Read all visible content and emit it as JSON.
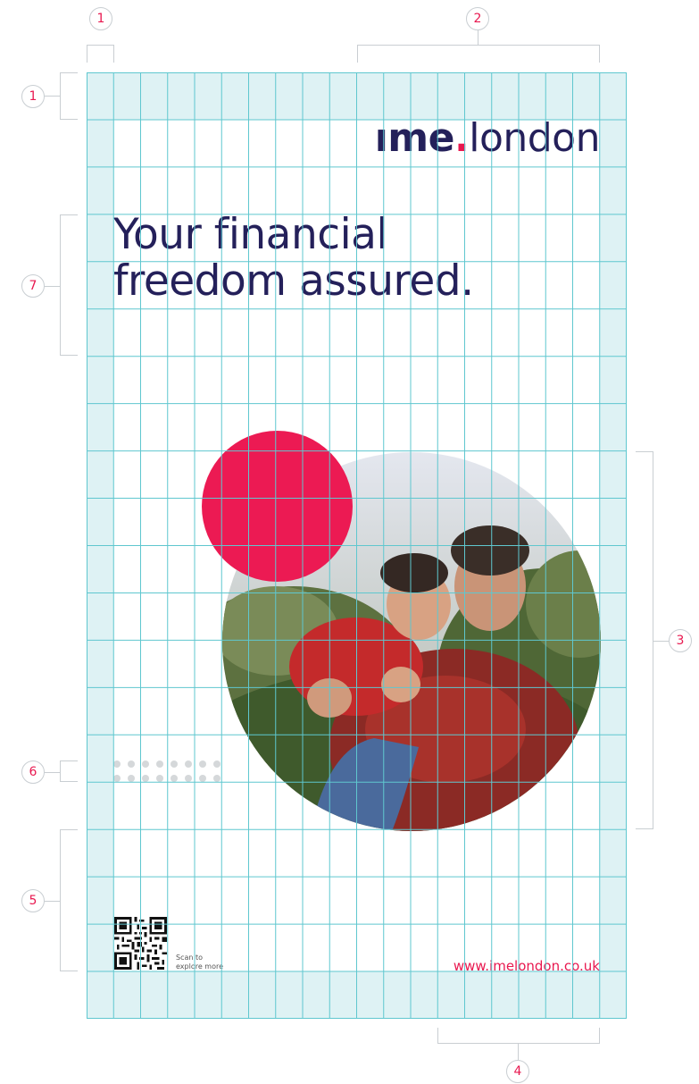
{
  "brand": {
    "logo_bold": "ıme",
    "logo_dot": ".",
    "logo_light": "london"
  },
  "headline": {
    "line1": "Your financial",
    "line2": "freedom assured."
  },
  "qr": {
    "caption_line1": "Scan to",
    "caption_line2": "explore more"
  },
  "footer": {
    "url": "www.imelondon.co.uk"
  },
  "annotations": {
    "top_margin_left": "1",
    "top_margin_width": "1",
    "logo_zone": "2",
    "image_zone": "3",
    "url_zone": "4",
    "footer_zone": "5",
    "dots_zone": "6",
    "headline_zone": "7"
  },
  "colors": {
    "navy": "#24205a",
    "pink": "#e8184f",
    "grid_line": "#5fc7cf",
    "margin_band": "#def2f4",
    "dots": "#d5d8da"
  },
  "icons": {
    "qr": "qr-code-icon",
    "photo": "family-photo",
    "accent": "red-circle-accent",
    "dots": "dot-pattern"
  }
}
